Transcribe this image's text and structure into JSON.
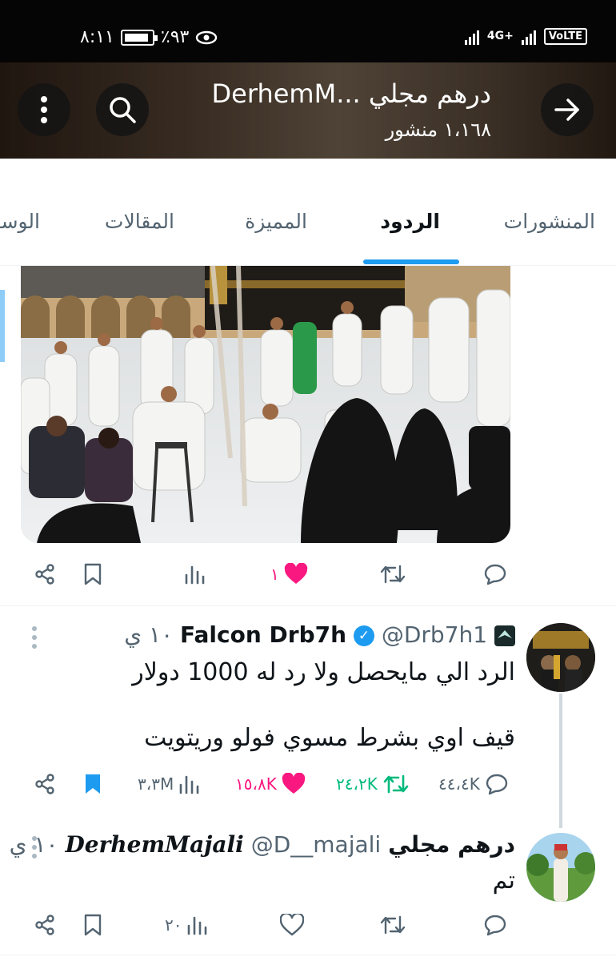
{
  "status_bar": {
    "time": "٨:١١",
    "battery_percent": "٪٩٣",
    "network_label": "4G+",
    "volte_label": "VoLTE"
  },
  "header": {
    "profile_title": "درهم مجلي ...DerhemM",
    "posts_count": "١،١٦٨ منشور"
  },
  "tabs": [
    {
      "label": "المنشورات",
      "active": false
    },
    {
      "label": "الردود",
      "active": true
    },
    {
      "label": "المميزة",
      "active": false
    },
    {
      "label": "المقالات",
      "active": false
    },
    {
      "label": "الوسائط",
      "active": false
    }
  ],
  "post_actions": {
    "likes": "١",
    "liked": true
  },
  "replies": [
    {
      "name": "Falcon Drb7h",
      "handle": "@Drb7h1",
      "time": "١٠ ي",
      "verified": true,
      "text_line_1": "الرد الي مايحصل ولا رد له 1000 دولار",
      "text_line_2": "قيف اوي بشرط مسوي فولو وريتويت",
      "stats": {
        "replies": "٤٤،٤K",
        "reposts": "٢٤،٢K",
        "likes": "١٥،٨K",
        "views": "٣،٣M",
        "bookmarked": true
      }
    },
    {
      "name": "درهم مجلي",
      "name_script": "DerhemMajali",
      "handle": "@D__majali",
      "time": "١٠ ي",
      "verified": false,
      "text_line_1": "تم",
      "stats": {
        "views": "٢٠",
        "bookmarked": false
      }
    }
  ],
  "colors": {
    "accent": "#1d9bf0",
    "like": "#f91880",
    "repost": "#00ba7c",
    "muted": "#536471"
  }
}
